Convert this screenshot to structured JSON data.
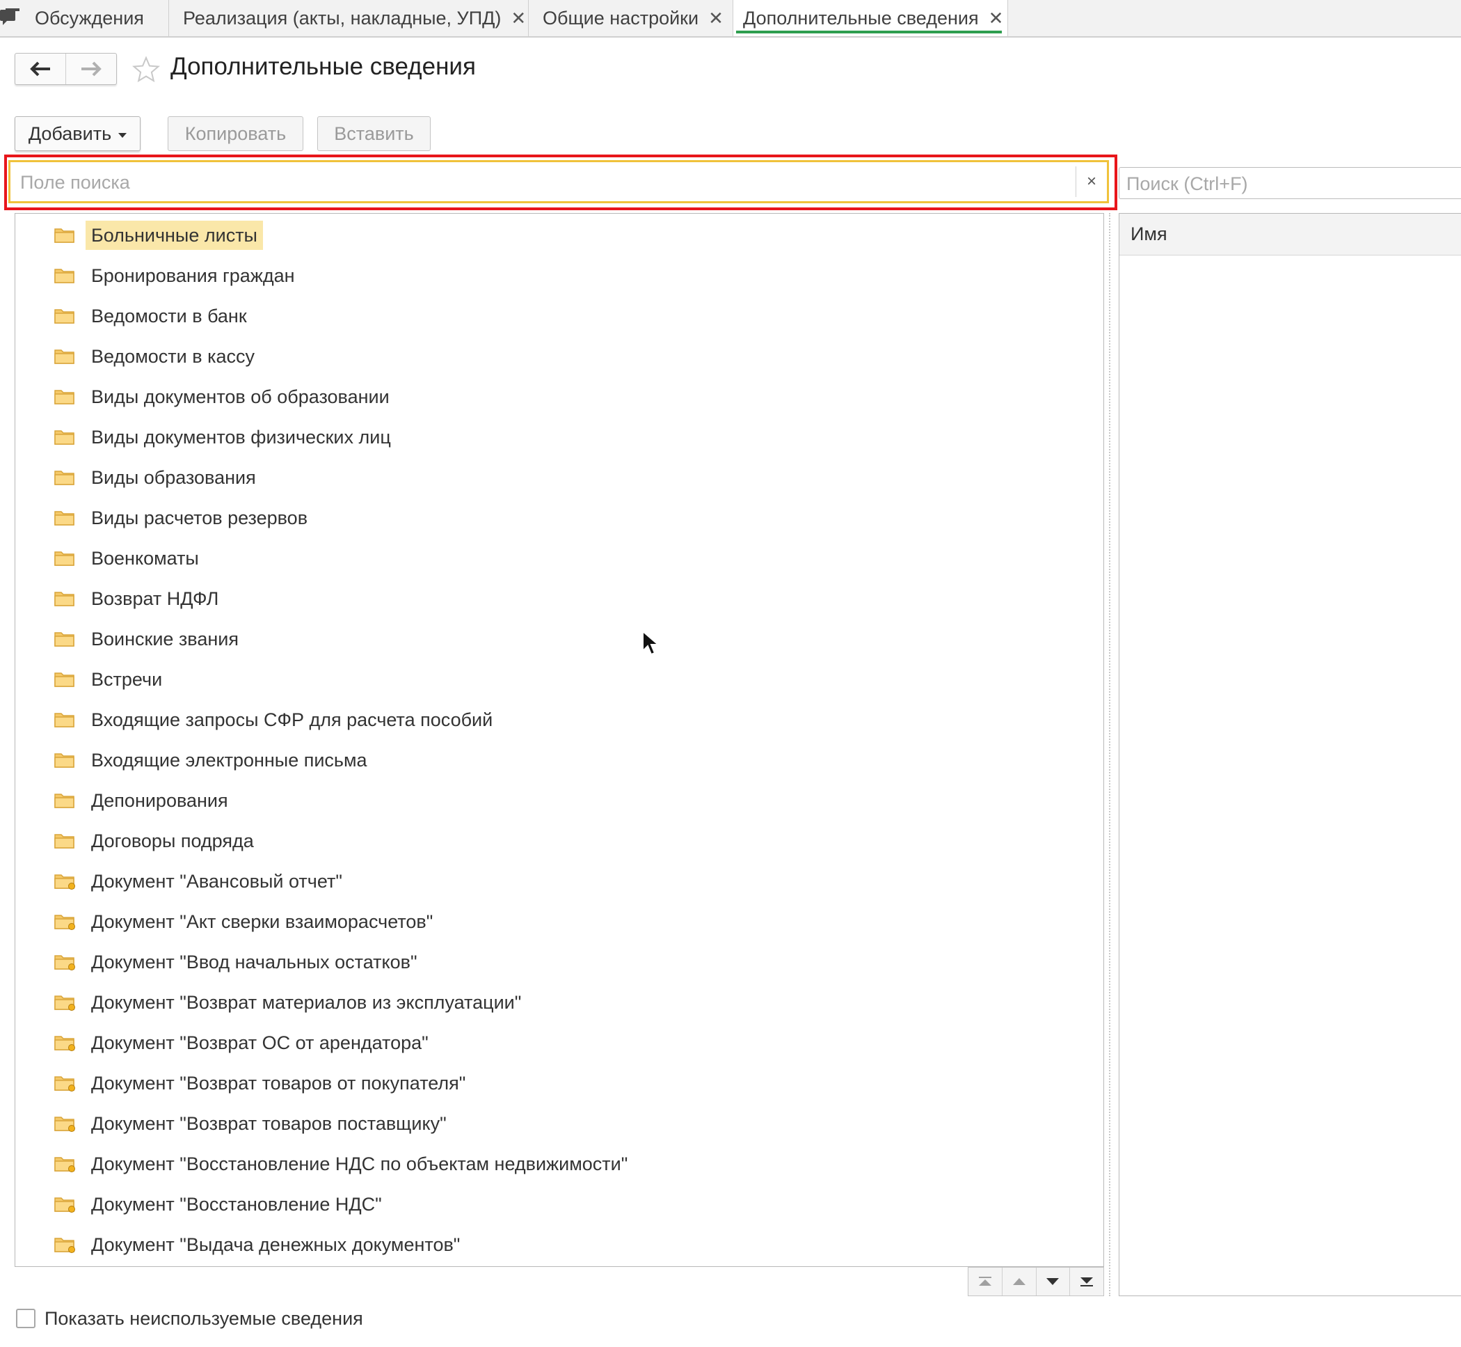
{
  "tabs": [
    {
      "label": "Обсуждения",
      "closable": false,
      "active": false,
      "icon": "chat-icon"
    },
    {
      "label": "Реализация (акты, накладные, УПД)",
      "closable": true,
      "active": false
    },
    {
      "label": "Общие настройки",
      "closable": true,
      "active": false
    },
    {
      "label": "Дополнительные сведения",
      "closable": true,
      "active": true
    }
  ],
  "header": {
    "title": "Дополнительные сведения",
    "back_icon": "arrow-left-icon",
    "forward_icon": "arrow-right-icon",
    "favorite_icon": "star-icon"
  },
  "toolbar": {
    "add_label": "Добавить",
    "copy_label": "Копировать",
    "paste_label": "Вставить"
  },
  "search": {
    "placeholder": "Поле поиска",
    "value": "",
    "clear_label": "×"
  },
  "right_search": {
    "placeholder": "Поиск (Ctrl+F)"
  },
  "tree": {
    "items": [
      {
        "label": "Больничные листы",
        "selected": true,
        "icon": "folder-icon"
      },
      {
        "label": "Бронирования граждан",
        "icon": "folder-icon"
      },
      {
        "label": "Ведомости в банк",
        "icon": "folder-icon"
      },
      {
        "label": "Ведомости в кассу",
        "icon": "folder-icon"
      },
      {
        "label": "Виды документов об образовании",
        "icon": "folder-icon"
      },
      {
        "label": "Виды документов физических лиц",
        "icon": "folder-icon"
      },
      {
        "label": "Виды образования",
        "icon": "folder-icon"
      },
      {
        "label": "Виды расчетов резервов",
        "icon": "folder-icon"
      },
      {
        "label": "Военкоматы",
        "icon": "folder-icon"
      },
      {
        "label": "Возврат НДФЛ",
        "icon": "folder-icon"
      },
      {
        "label": "Воинские звания",
        "icon": "folder-icon"
      },
      {
        "label": "Встречи",
        "icon": "folder-icon"
      },
      {
        "label": "Входящие запросы СФР для расчета пособий",
        "icon": "folder-icon"
      },
      {
        "label": "Входящие электронные письма",
        "icon": "folder-icon"
      },
      {
        "label": "Депонирования",
        "icon": "folder-icon"
      },
      {
        "label": "Договоры подряда",
        "icon": "folder-icon"
      },
      {
        "label": "Документ \"Авансовый отчет\"",
        "icon": "folder-badge-icon"
      },
      {
        "label": "Документ \"Акт сверки взаиморасчетов\"",
        "icon": "folder-badge-icon"
      },
      {
        "label": "Документ \"Ввод начальных остатков\"",
        "icon": "folder-badge-icon"
      },
      {
        "label": "Документ \"Возврат материалов из эксплуатации\"",
        "icon": "folder-badge-icon"
      },
      {
        "label": "Документ \"Возврат ОС от арендатора\"",
        "icon": "folder-badge-icon"
      },
      {
        "label": "Документ \"Возврат товаров от покупателя\"",
        "icon": "folder-badge-icon"
      },
      {
        "label": "Документ \"Возврат товаров поставщику\"",
        "icon": "folder-badge-icon"
      },
      {
        "label": "Документ \"Восстановление НДС по объектам недвижимости\"",
        "icon": "folder-badge-icon"
      },
      {
        "label": "Документ \"Восстановление НДС\"",
        "icon": "folder-badge-icon"
      },
      {
        "label": "Документ \"Выдача денежных документов\"",
        "icon": "folder-badge-icon"
      }
    ]
  },
  "right_panel": {
    "column_header": "Имя"
  },
  "footer": {
    "show_unused_label": "Показать неиспользуемые сведения",
    "show_unused_checked": false
  },
  "colors": {
    "highlight_red": "#e8161b",
    "focus_yellow": "#f0c23b",
    "selected_row": "#fae7a9",
    "active_tab_underline": "#2e9e4f",
    "folder": "#f5c969"
  }
}
